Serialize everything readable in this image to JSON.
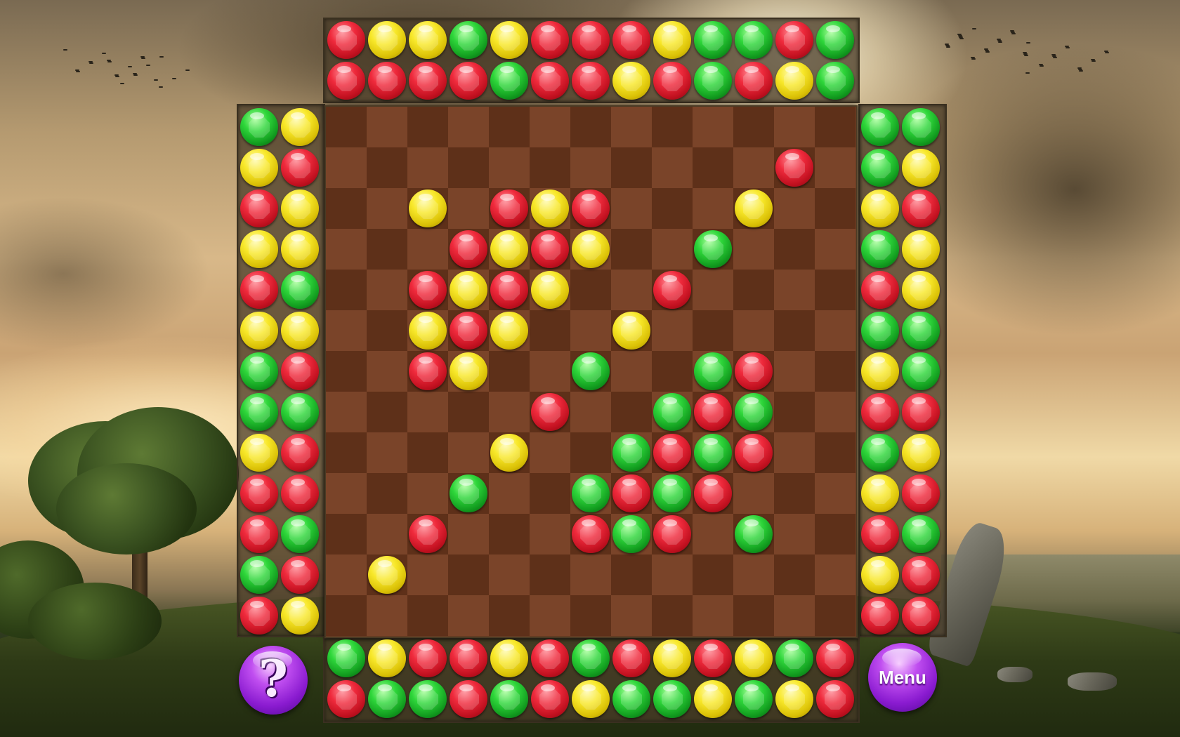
{
  "game": {
    "board_size": 13,
    "colors": {
      "red": "#ef2a3c",
      "yellow": "#f8e82a",
      "green": "#2ed63a",
      "button": "#a030e0"
    },
    "top_rows": [
      [
        "red",
        "yellow",
        "yellow",
        "green",
        "yellow",
        "red",
        "red",
        "red",
        "yellow",
        "green",
        "green",
        "red",
        "green"
      ],
      [
        "red",
        "red",
        "red",
        "red",
        "green",
        "red",
        "red",
        "yellow",
        "red",
        "green",
        "red",
        "yellow",
        "green"
      ]
    ],
    "bottom_rows": [
      [
        "green",
        "yellow",
        "red",
        "red",
        "yellow",
        "red",
        "green",
        "red",
        "yellow",
        "red",
        "yellow",
        "green",
        "red"
      ],
      [
        "red",
        "green",
        "green",
        "red",
        "green",
        "red",
        "yellow",
        "green",
        "green",
        "yellow",
        "green",
        "yellow",
        "red"
      ]
    ],
    "left_rows": [
      [
        "green",
        "yellow"
      ],
      [
        "yellow",
        "red"
      ],
      [
        "red",
        "yellow"
      ],
      [
        "yellow",
        "yellow"
      ],
      [
        "red",
        "green"
      ],
      [
        "yellow",
        "yellow"
      ],
      [
        "green",
        "red"
      ],
      [
        "green",
        "green"
      ],
      [
        "yellow",
        "red"
      ],
      [
        "red",
        "red"
      ],
      [
        "red",
        "green"
      ],
      [
        "green",
        "red"
      ],
      [
        "red",
        "yellow"
      ]
    ],
    "right_rows": [
      [
        "green",
        "green"
      ],
      [
        "green",
        "yellow"
      ],
      [
        "yellow",
        "red"
      ],
      [
        "green",
        "yellow"
      ],
      [
        "red",
        "yellow"
      ],
      [
        "green",
        "green"
      ],
      [
        "yellow",
        "green"
      ],
      [
        "red",
        "red"
      ],
      [
        "green",
        "yellow"
      ],
      [
        "yellow",
        "red"
      ],
      [
        "red",
        "green"
      ],
      [
        "yellow",
        "red"
      ],
      [
        "red",
        "red"
      ]
    ],
    "board_gems": [
      {
        "r": 1,
        "c": 11,
        "color": "red"
      },
      {
        "r": 2,
        "c": 2,
        "color": "yellow"
      },
      {
        "r": 2,
        "c": 4,
        "color": "red"
      },
      {
        "r": 2,
        "c": 5,
        "color": "yellow"
      },
      {
        "r": 2,
        "c": 6,
        "color": "red"
      },
      {
        "r": 2,
        "c": 10,
        "color": "yellow"
      },
      {
        "r": 3,
        "c": 3,
        "color": "red"
      },
      {
        "r": 3,
        "c": 4,
        "color": "yellow"
      },
      {
        "r": 3,
        "c": 5,
        "color": "red"
      },
      {
        "r": 3,
        "c": 6,
        "color": "yellow"
      },
      {
        "r": 3,
        "c": 9,
        "color": "green"
      },
      {
        "r": 4,
        "c": 2,
        "color": "red"
      },
      {
        "r": 4,
        "c": 3,
        "color": "yellow"
      },
      {
        "r": 4,
        "c": 4,
        "color": "red"
      },
      {
        "r": 4,
        "c": 5,
        "color": "yellow"
      },
      {
        "r": 4,
        "c": 8,
        "color": "red"
      },
      {
        "r": 5,
        "c": 2,
        "color": "yellow"
      },
      {
        "r": 5,
        "c": 3,
        "color": "red"
      },
      {
        "r": 5,
        "c": 4,
        "color": "yellow"
      },
      {
        "r": 5,
        "c": 7,
        "color": "yellow"
      },
      {
        "r": 6,
        "c": 2,
        "color": "red"
      },
      {
        "r": 6,
        "c": 3,
        "color": "yellow"
      },
      {
        "r": 6,
        "c": 6,
        "color": "green"
      },
      {
        "r": 6,
        "c": 9,
        "color": "green"
      },
      {
        "r": 6,
        "c": 10,
        "color": "red"
      },
      {
        "r": 7,
        "c": 5,
        "color": "red"
      },
      {
        "r": 7,
        "c": 8,
        "color": "green"
      },
      {
        "r": 7,
        "c": 9,
        "color": "red"
      },
      {
        "r": 7,
        "c": 10,
        "color": "green"
      },
      {
        "r": 8,
        "c": 4,
        "color": "yellow"
      },
      {
        "r": 8,
        "c": 7,
        "color": "green"
      },
      {
        "r": 8,
        "c": 8,
        "color": "red"
      },
      {
        "r": 8,
        "c": 9,
        "color": "green"
      },
      {
        "r": 8,
        "c": 10,
        "color": "red"
      },
      {
        "r": 9,
        "c": 3,
        "color": "green"
      },
      {
        "r": 9,
        "c": 6,
        "color": "green"
      },
      {
        "r": 9,
        "c": 7,
        "color": "red"
      },
      {
        "r": 9,
        "c": 8,
        "color": "green"
      },
      {
        "r": 9,
        "c": 9,
        "color": "red"
      },
      {
        "r": 10,
        "c": 2,
        "color": "red"
      },
      {
        "r": 10,
        "c": 6,
        "color": "red"
      },
      {
        "r": 10,
        "c": 7,
        "color": "green"
      },
      {
        "r": 10,
        "c": 8,
        "color": "red"
      },
      {
        "r": 10,
        "c": 10,
        "color": "green"
      },
      {
        "r": 11,
        "c": 1,
        "color": "yellow"
      }
    ]
  },
  "buttons": {
    "help_glyph": "?",
    "menu_label": "Menu"
  }
}
